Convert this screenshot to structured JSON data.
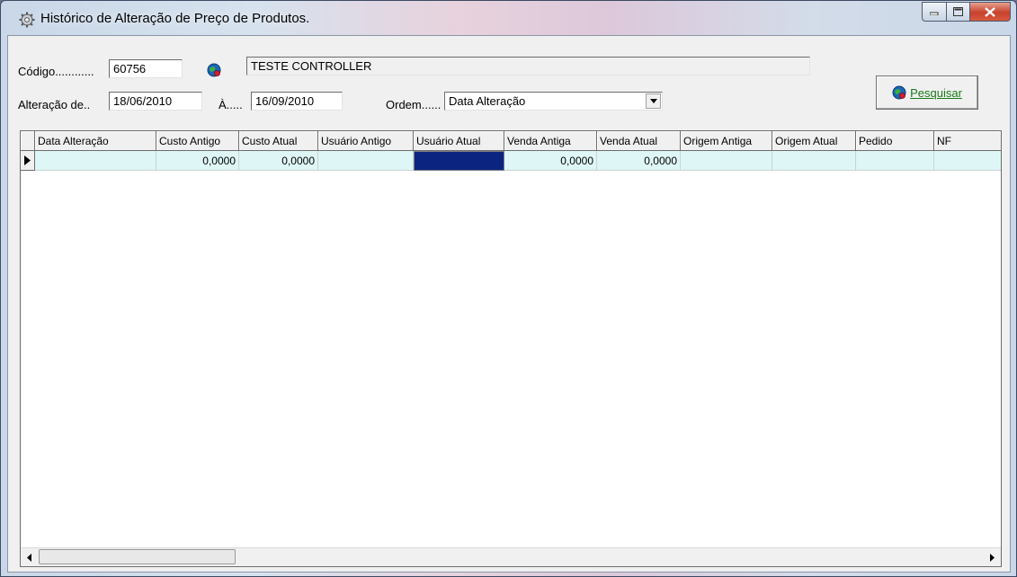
{
  "window": {
    "title": "Histórico de Alteração de Preço de Produtos."
  },
  "form": {
    "codigo_label": "Código............",
    "codigo_value": "60756",
    "product_name": "TESTE CONTROLLER",
    "alteracao_label": "Alteração de..",
    "date_from": "18/06/2010",
    "ate_label": "À.....",
    "date_to": "16/09/2010",
    "ordem_label": "Ordem......",
    "ordem_value": "Data Alteração",
    "search_button": "Pesquisar"
  },
  "grid": {
    "columns": [
      "Data Alteração",
      "Custo Antigo",
      "Custo Atual",
      "Usuário Antigo",
      "Usuário Atual",
      "Venda Antiga",
      "Venda Atual",
      "Origem Antiga",
      "Origem Atual",
      "Pedido",
      "NF"
    ],
    "rows": [
      [
        "",
        "0,0000",
        "0,0000",
        "",
        "",
        "0,0000",
        "0,0000",
        "",
        "",
        "",
        ""
      ]
    ]
  },
  "colors": {
    "row_background": "#dff6f6",
    "selected_cell": "#0a2480",
    "search_text": "#1a7a1a"
  }
}
